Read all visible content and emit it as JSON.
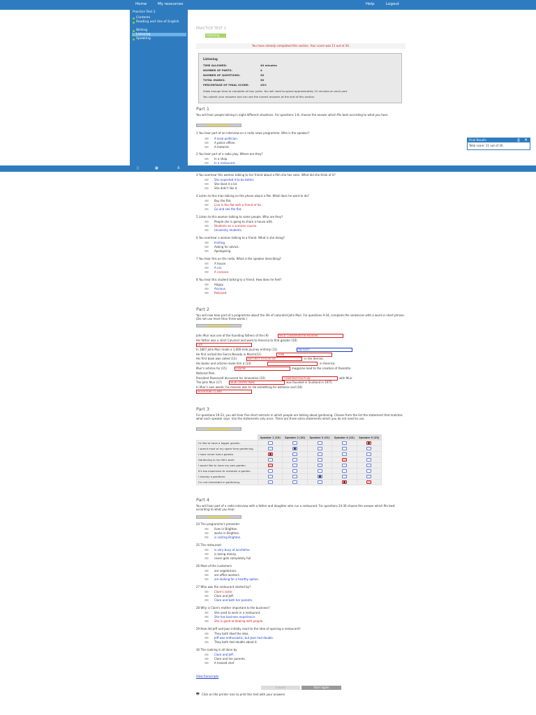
{
  "topbar": {
    "home": "Home",
    "resources": "My resources",
    "help": "Help",
    "logout": "Logout"
  },
  "sidebar": {
    "title": "Practice Test 2",
    "items": [
      "Contents",
      "Reading and Use of English",
      "Writing",
      "Listening",
      "Speaking"
    ]
  },
  "header": {
    "title": "PRACTICE TEST 2",
    "tab": "Listening"
  },
  "notice": "You have already completed this section. Your score was 11 out of 30.",
  "info": {
    "heading": "Listening",
    "rows": [
      {
        "k": "TIME ALLOWED:",
        "v": "40 minutes"
      },
      {
        "k": "NUMBER OF PARTS:",
        "v": "4"
      },
      {
        "k": "NUMBER OF QUESTIONS:",
        "v": "30"
      },
      {
        "k": "TOTAL MARKS:",
        "v": "30"
      },
      {
        "k": "PERCENTAGE OF FINAL SCORE:",
        "v": "20%"
      }
    ],
    "p1": "Allow enough time to complete all four parts. You will need to spend approximately 10 minutes on each part.",
    "p2": "You submit your answers and can see the correct answers at the end of this section."
  },
  "final": {
    "title": "Final Results",
    "score": "Total score: 11 out of 30."
  },
  "part1": {
    "heading": "Part 1",
    "intro": "You will hear people talking in eight different situations. For questions 1-8, choose the answer which fits best according to what you hear.",
    "q1": "1 You hear part of an interview on a radio news programme. Who is the speaker?",
    "q1o": [
      "A local politician.",
      "A police officer.",
      "A motorist."
    ],
    "q2": "2 You hear part of a radio play. Where are they?",
    "q2o": [
      "In a shop.",
      "In a restaurant."
    ],
    "q3": "3 You overhear this woman talking to her friend about a film she has seen. What did she think of it?",
    "q3o": [
      "She expected it to be better.",
      "She liked it a lot.",
      "She didn't like it."
    ],
    "q4": "4 Listen to this man talking on the phone about a flat. What does he want to do?",
    "q4o": [
      "Buy the flat.",
      "Live in the flat with a friend of his.",
      "Go and see the flat."
    ],
    "q5": "5 Listen to this woman talking to some people. Who are they?",
    "q5o": [
      "People she is going to share a house with.",
      "Students on a summer course.",
      "University students."
    ],
    "q6": "6 You overhear a woman talking to a friend. What is she doing?",
    "q6o": [
      "Inviting.",
      "Asking for advice.",
      "Apologising."
    ],
    "q7": "7 You hear this on the radio. What is the speaker describing?",
    "q7o": [
      "A house.",
      "A car.",
      "A caravan."
    ],
    "q8": "8 You hear this student talking to a friend. How does he feel?",
    "q8o": [
      "Happy.",
      "Anxious.",
      "Relieved."
    ]
  },
  "part2": {
    "heading": "Part 2",
    "intro": "You will now hear part of a programme about the life of naturalist John Muir. For questions 9-18, complete the sentences with a word or short phrase. (Do not use more than three words.)",
    "l1a": "John Muir was one of the founding fathers of the (9)",
    "g9": "WILD CONSERVATION MOVEME",
    "l2a": "His father was a strict Calvinist and went to America to find greater (10)",
    "g10": "LIFE",
    "l3a": "In 1867 John Muir made a 1,000-mile journey entirely (11)",
    "g11": "ON FOOT",
    "l4a": "He first visited the Sierra Nevada in March(12)",
    "g12": "1968",
    "l4b": "in the Sierras.",
    "l5a": "His first book was called (13)",
    "g13": "NATURIST EXISORCISE",
    "l6a": "His books and articles made him a (14)",
    "l6b": "in America.",
    "l7a": "Muir's articles for (15)",
    "g15": "CENTRY",
    "l7b": "magazine lead to the creation of Yosemite",
    "l8a": "National Park.",
    "l9a": "President Roosevelt discussed his innovative (16)",
    "g16": "CONSERVATION PLAN",
    "l9b": "with Muir.",
    "l10a": "The John Muir (17)",
    "g17": "MUIR CENTRY PARK",
    "l10b": "was founded in Scotland in 1975.",
    "l11a": "In Muir's own words, his mission was to 'do something for wildness and (18)",
    "g18": "MOUNTAINS CLARR"
  },
  "part3": {
    "heading": "Part 3",
    "intro": "For questions 19-23, you will hear five short extracts in which people are talking about gardening. Choose from the list the statement that matches what each speaker says. Use the statements only once. There are three extra statements which you do not need to use.",
    "speakers": [
      "Speaker 1 (19)",
      "Speaker 2 (20)",
      "Speaker 3 (21)",
      "Speaker 4 (22)",
      "Speaker 5 (23)"
    ],
    "statements": [
      "I'd like to have a bigger garden.",
      "I spend most of my spare time gardening.",
      "I have never had a garden.",
      "Gardening is my life's work.",
      "I would like to have my own garden.",
      "It's too expensive to maintain a garden.",
      "I employ a gardener.",
      "I'm not interested in gardening."
    ]
  },
  "part4": {
    "heading": "Part 4",
    "intro": "You will hear part of a radio interview with a father and daughter who run a restaurant. For questions 24-30 choose the answer which fits best according to what you hear.",
    "q24": "24 The programme's presenter",
    "q24o": [
      "lives in Brighton.",
      "works in Brighton.",
      "is visiting Brighton."
    ],
    "q25": "25 The restaurant",
    "q25o": [
      "is very busy at lunchtime.",
      "is losing money.",
      "never gets completely full."
    ],
    "q26": "26 Most of the customers",
    "q26o": [
      "are vegetarians.",
      "are office workers.",
      "are looking for a healthy option."
    ],
    "q27": "27 Who was the restaurant started by?",
    "q27o": [
      "Clare's sister.",
      "Clare and Jeff.",
      "Clare and both her parents."
    ],
    "q28": "28 Why is Clare's mother important to the business?",
    "q28o": [
      "She used to work in a restaurant.",
      "She has business experience.",
      "She is good at dealing with people."
    ],
    "q29": "29 How did Jeff and Joan initially react to the idea of opening a restaurant?",
    "q29o": [
      "They both liked the idea.",
      "Jeff was enthusiastic, but Joan had doubts.",
      "They both had doubts about it."
    ],
    "q30": "30 The cooking is all done by",
    "q30o": [
      "Clare and Jeff.",
      "Clare and her parents.",
      "A trained chef."
    ],
    "transcripts": "View transcripts",
    "submit": "Submit",
    "again": "Start again",
    "print": "Click on the printer icon to print this test with your answers."
  }
}
